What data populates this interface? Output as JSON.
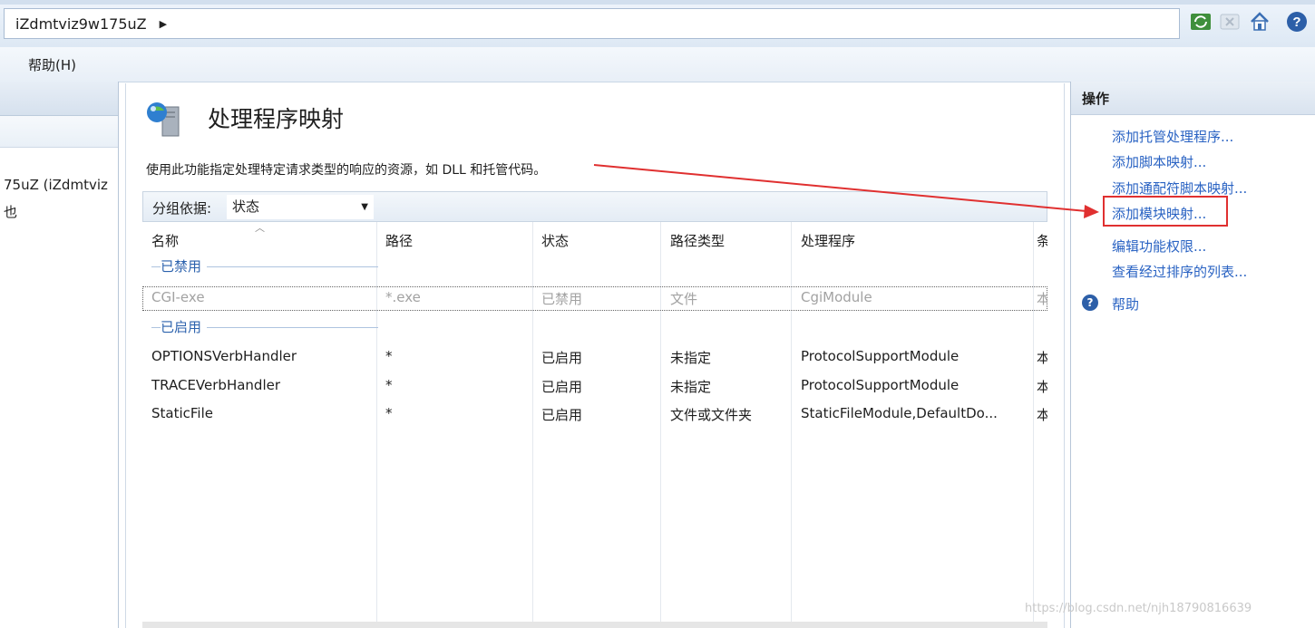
{
  "address_bar": {
    "path": "iZdmtviz9w175uZ"
  },
  "menu": {
    "help": "帮助(H)"
  },
  "connections": {
    "node_text": "75uZ (iZdmtviz",
    "child_text": "也"
  },
  "feature": {
    "title": "处理程序映射",
    "description": "使用此功能指定处理特定请求类型的响应的资源，如 DLL 和托管代码。",
    "group_by_label": "分组依据:",
    "group_by_value": "状态"
  },
  "grid": {
    "columns": [
      "名称",
      "路径",
      "状态",
      "路径类型",
      "处理程序",
      "条"
    ],
    "groups": [
      {
        "label": "已禁用",
        "rows": [
          [
            "CGI-exe",
            "*.exe",
            "已禁用",
            "文件",
            "CgiModule",
            "本"
          ]
        ]
      },
      {
        "label": "已启用",
        "rows": [
          [
            "OPTIONSVerbHandler",
            "*",
            "已启用",
            "未指定",
            "ProtocolSupportModule",
            "本"
          ],
          [
            "TRACEVerbHandler",
            "*",
            "已启用",
            "未指定",
            "ProtocolSupportModule",
            "本"
          ],
          [
            "StaticFile",
            "*",
            "已启用",
            "文件或文件夹",
            "StaticFileModule,DefaultDo...",
            "本"
          ]
        ]
      }
    ]
  },
  "actions": {
    "title": "操作",
    "items": [
      "添加托管处理程序...",
      "添加脚本映射...",
      "添加通配符脚本映射...",
      "添加模块映射...",
      "编辑功能权限...",
      "查看经过排序的列表..."
    ],
    "help": "帮助"
  },
  "watermark": "https://blog.csdn.net/njh18790816639",
  "colors": {
    "link": "#2a63c3",
    "highlight": "#e03030",
    "group_label": "#2c62ad"
  }
}
